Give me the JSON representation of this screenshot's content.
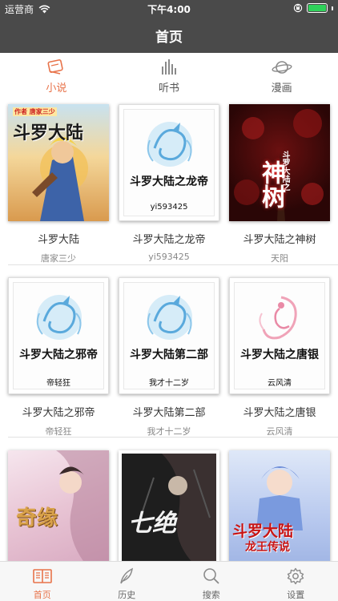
{
  "status_bar": {
    "carrier": "运营商",
    "time": "下午4:00"
  },
  "nav": {
    "title": "首页"
  },
  "category_tabs": [
    {
      "label": "小说",
      "icon": "book-icon",
      "active": true
    },
    {
      "label": "听书",
      "icon": "audio-bars-icon",
      "active": false
    },
    {
      "label": "漫画",
      "icon": "planet-icon",
      "active": false
    }
  ],
  "books": [
    {
      "title": "斗罗大陆",
      "author": "唐家三少",
      "cover_text": "斗罗大陆",
      "cover_sub": "作者 唐家三少"
    },
    {
      "title": "斗罗大陆之龙帝",
      "author": "yi593425",
      "cover_text": "斗罗大陆之龙帝",
      "cover_author": "yi593425"
    },
    {
      "title": "斗罗大陆之神树",
      "author": "天阳",
      "cover_text": "神树",
      "cover_sub": "斗罗大陆之"
    },
    {
      "title": "斗罗大陆之邪帝",
      "author": "帝轻狂",
      "cover_text": "斗罗大陆之邪帝",
      "cover_author": "帝轻狂"
    },
    {
      "title": "斗罗大陆第二部",
      "author": "我才十二岁",
      "cover_text": "斗罗大陆第二部",
      "cover_author": "我才十二岁"
    },
    {
      "title": "斗罗大陆之唐银",
      "author": "云风清",
      "cover_text": "斗罗大陆之唐银",
      "cover_author": "云风清"
    },
    {
      "cover_text": "奇缘"
    },
    {
      "cover_text": "七绝"
    },
    {
      "cover_text": "斗罗大陆",
      "cover_sub": "龙王传说"
    }
  ],
  "tab_bar": [
    {
      "label": "首页",
      "icon": "book-open-icon",
      "active": true
    },
    {
      "label": "历史",
      "icon": "feather-icon",
      "active": false
    },
    {
      "label": "搜索",
      "icon": "search-icon",
      "active": false
    },
    {
      "label": "设置",
      "icon": "gear-icon",
      "active": false
    }
  ],
  "colors": {
    "header": "#4a4a4a",
    "accent": "#e8734a",
    "battery": "#2fd15a"
  }
}
